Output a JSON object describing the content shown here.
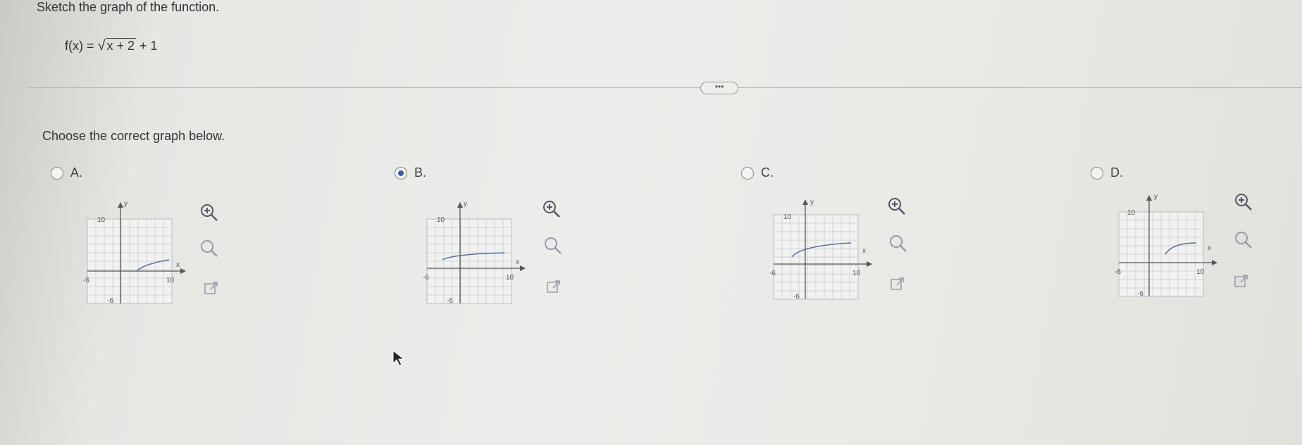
{
  "question": {
    "instruction": "Sketch the graph of the function.",
    "formula_prefix": "f(x) = ",
    "formula_radicand": "x + 2",
    "formula_suffix": " + 1",
    "more_label": "•••",
    "prompt": "Choose the correct graph below."
  },
  "options": [
    {
      "label": "A.",
      "selected": false
    },
    {
      "label": "B.",
      "selected": true
    },
    {
      "label": "C.",
      "selected": false
    },
    {
      "label": "D.",
      "selected": false
    }
  ],
  "graph_labels": {
    "y_axis": "y",
    "x_axis": "x",
    "y_max": "10",
    "x_min": "-6",
    "x_max": "10",
    "y_min": "-6"
  },
  "tools": {
    "zoom_in": "zoom-in-icon",
    "zoom_out": "zoom-out-icon",
    "popout": "popout-icon"
  },
  "colors": {
    "accent": "#3a5fa8",
    "curve": "#5a6f9e"
  }
}
